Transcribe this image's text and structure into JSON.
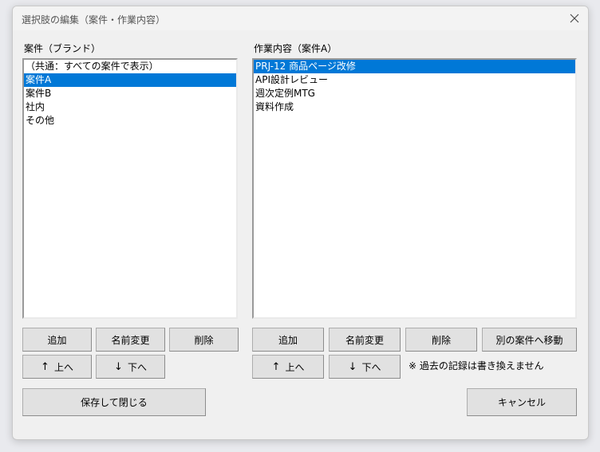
{
  "window": {
    "title": "選択肢の編集（案件・作業内容）",
    "close_glyph": "✕"
  },
  "left": {
    "heading": "案件（ブランド）",
    "items": [
      "（共通：すべての案件で表示）",
      "案件A",
      "案件B",
      "社内",
      "その他"
    ],
    "selected_index": 1,
    "buttons": {
      "add": "追加",
      "rename": "名前変更",
      "delete": "削除",
      "up": "上へ",
      "down": "下へ"
    }
  },
  "right": {
    "heading": "作業内容（案件A）",
    "items": [
      "PRJ-12 商品ページ改修",
      "API設計レビュー",
      "週次定例MTG",
      "資料作成"
    ],
    "selected_index": 0,
    "buttons": {
      "add": "追加",
      "rename": "名前変更",
      "delete": "削除",
      "move": "別の案件へ移動",
      "up": "上へ",
      "down": "下へ"
    },
    "note": "※ 過去の記録は書き換えません"
  },
  "footer": {
    "save_close": "保存して閉じる",
    "cancel": "キャンセル"
  },
  "icons": {
    "up_arrow": "↑",
    "down_arrow": "↓"
  },
  "colors": {
    "selection": "#0078d7"
  }
}
